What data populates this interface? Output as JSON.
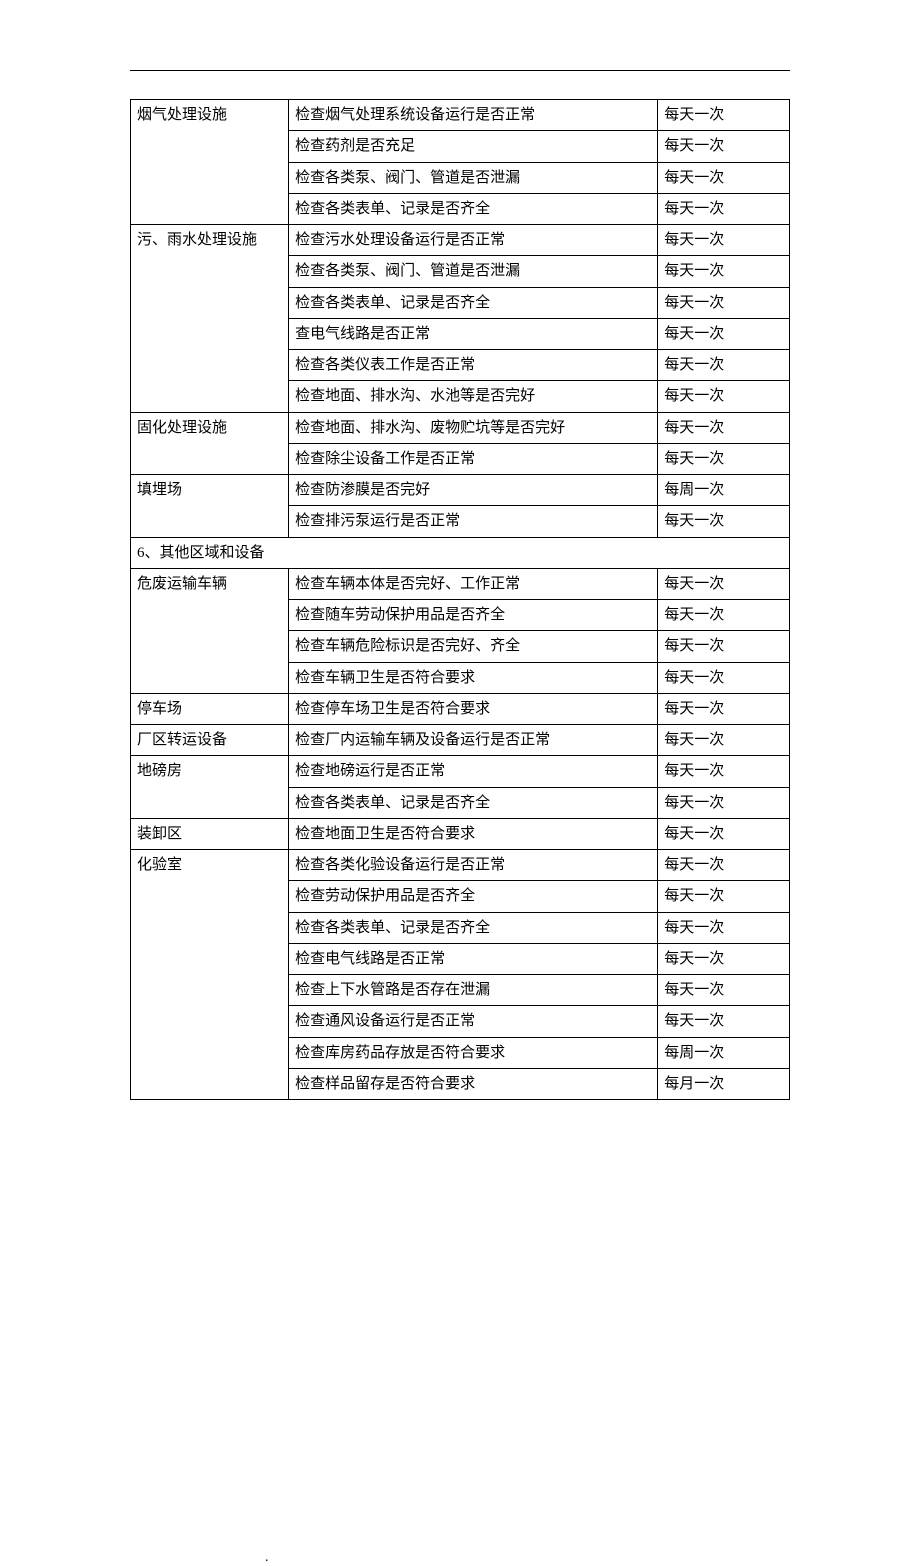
{
  "freq": {
    "daily": "每天一次",
    "weekly": "每周一次",
    "monthly": "每月一次"
  },
  "sections": {
    "other": "6、其他区域和设备"
  },
  "groups": [
    {
      "label": "烟气处理设施",
      "rows": [
        {
          "item": "检查烟气处理系统设备运行是否正常",
          "freq": "daily"
        },
        {
          "item": "检查药剂是否充足",
          "freq": "daily"
        },
        {
          "item": "检查各类泵、阀门、管道是否泄漏",
          "freq": "daily"
        },
        {
          "item": "检查各类表单、记录是否齐全",
          "freq": "daily"
        }
      ]
    },
    {
      "label": "污、雨水处理设施",
      "rows": [
        {
          "item": "检查污水处理设备运行是否正常",
          "freq": "daily"
        },
        {
          "item": "检查各类泵、阀门、管道是否泄漏",
          "freq": "daily"
        },
        {
          "item": "检查各类表单、记录是否齐全",
          "freq": "daily"
        },
        {
          "item": "查电气线路是否正常",
          "freq": "daily"
        },
        {
          "item": "检查各类仪表工作是否正常",
          "freq": "daily"
        },
        {
          "item": "检查地面、排水沟、水池等是否完好",
          "freq": "daily"
        }
      ]
    },
    {
      "label": "固化处理设施",
      "rows": [
        {
          "item": "检查地面、排水沟、废物贮坑等是否完好",
          "freq": "daily"
        },
        {
          "item": "检查除尘设备工作是否正常",
          "freq": "daily"
        }
      ]
    },
    {
      "label": "填埋场",
      "rows": [
        {
          "item": "检查防渗膜是否完好",
          "freq": "weekly"
        },
        {
          "item": "检查排污泵运行是否正常",
          "freq": "daily"
        }
      ]
    },
    {
      "label": "危废运输车辆",
      "rows": [
        {
          "item": "检查车辆本体是否完好、工作正常",
          "freq": "daily"
        },
        {
          "item": "检查随车劳动保护用品是否齐全",
          "freq": "daily"
        },
        {
          "item": "检查车辆危险标识是否完好、齐全",
          "freq": "daily"
        },
        {
          "item": "检查车辆卫生是否符合要求",
          "freq": "daily"
        }
      ]
    },
    {
      "label": "停车场",
      "rows": [
        {
          "item": "检查停车场卫生是否符合要求",
          "freq": "daily"
        }
      ]
    },
    {
      "label": "厂区转运设备",
      "rows": [
        {
          "item": "检查厂内运输车辆及设备运行是否正常",
          "freq": "daily"
        }
      ]
    },
    {
      "label": "地磅房",
      "rows": [
        {
          "item": "检查地磅运行是否正常",
          "freq": "daily"
        },
        {
          "item": "检查各类表单、记录是否齐全",
          "freq": "daily"
        }
      ]
    },
    {
      "label": "装卸区",
      "rows": [
        {
          "item": "检查地面卫生是否符合要求",
          "freq": "daily"
        }
      ]
    },
    {
      "label": "化验室",
      "rows": [
        {
          "item": "检查各类化验设备运行是否正常",
          "freq": "daily"
        },
        {
          "item": "检查劳动保护用品是否齐全",
          "freq": "daily"
        },
        {
          "item": "检查各类表单、记录是否齐全",
          "freq": "daily"
        },
        {
          "item": "检查电气线路是否正常",
          "freq": "daily"
        },
        {
          "item": "检查上下水管路是否存在泄漏",
          "freq": "daily"
        },
        {
          "item": "检查通风设备运行是否正常",
          "freq": "daily"
        },
        {
          "item": "检查库房药品存放是否符合要求",
          "freq": "weekly"
        },
        {
          "item": "检查样品留存是否符合要求",
          "freq": "monthly"
        }
      ]
    }
  ],
  "sectionAfterGroup": 3
}
